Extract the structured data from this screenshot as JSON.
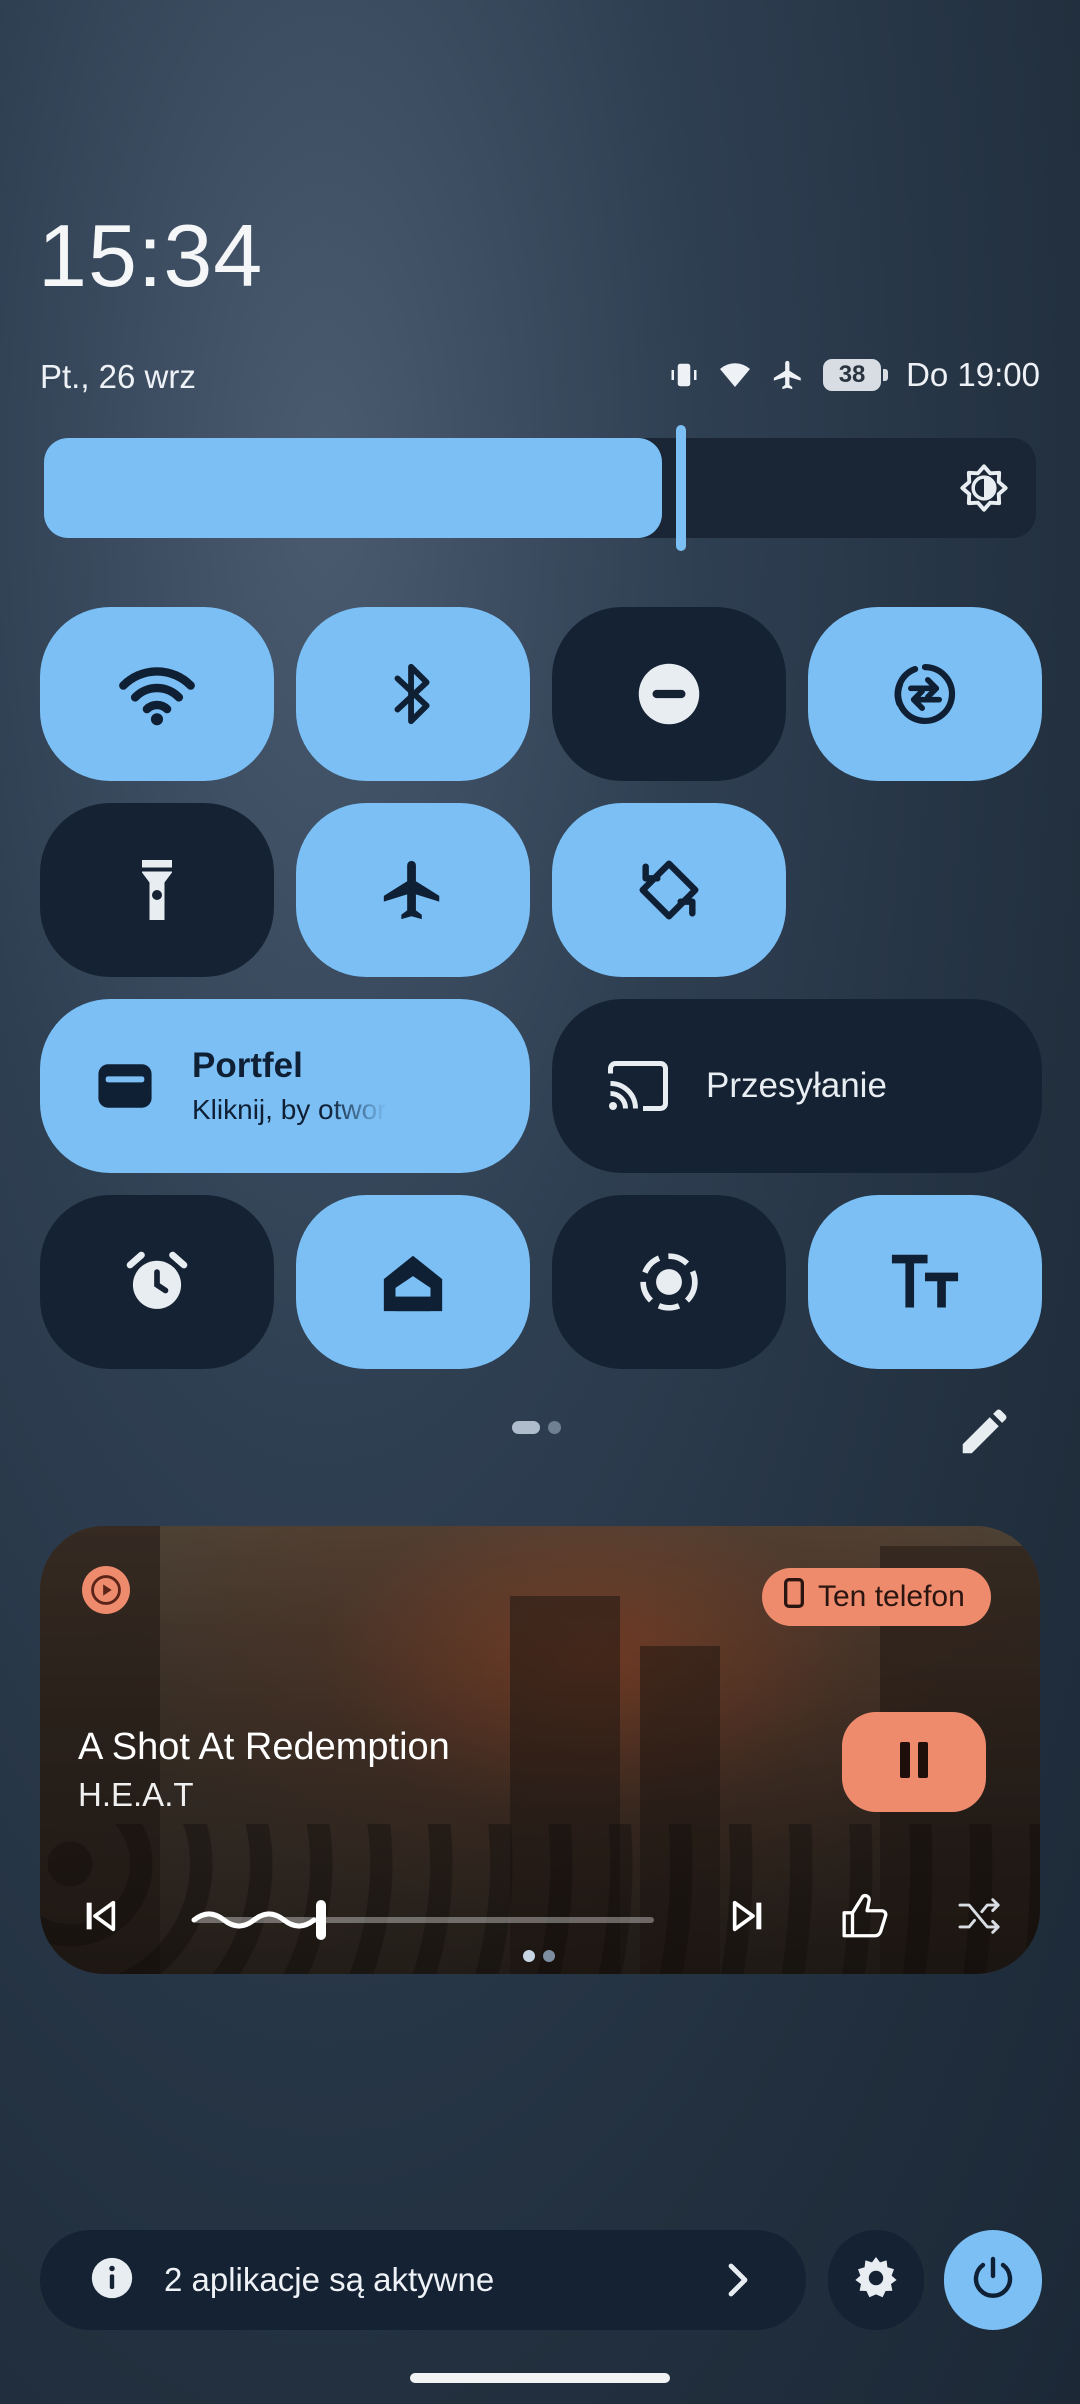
{
  "header": {
    "time": "15:34",
    "date": "Pt., 26 wrz",
    "battery_level": "38",
    "battery_label": "Do 19:00",
    "status_icons": [
      "vibrate-icon",
      "wifi-icon",
      "airplane-icon",
      "battery-icon"
    ]
  },
  "brightness": {
    "level_fraction": 0.62,
    "icon": "brightness-auto-icon"
  },
  "tiles": {
    "wifi": {
      "icon": "wifi-icon",
      "state": "on"
    },
    "bluetooth": {
      "icon": "bluetooth-icon",
      "state": "on"
    },
    "dnd": {
      "icon": "do-not-disturb-icon",
      "state": "off"
    },
    "data_saver": {
      "icon": "data-saver-icon",
      "state": "on"
    },
    "flashlight": {
      "icon": "flashlight-icon",
      "state": "off"
    },
    "airplane": {
      "icon": "airplane-icon",
      "state": "on"
    },
    "autorotate": {
      "icon": "auto-rotate-icon",
      "state": "on"
    },
    "wallet": {
      "title": "Portfel",
      "subtitle": "Kliknij, by otworzyć",
      "icon": "wallet-icon",
      "state": "on"
    },
    "cast": {
      "title": "Przesyłanie",
      "icon": "cast-icon",
      "state": "off"
    },
    "alarm": {
      "icon": "alarm-icon",
      "state": "off"
    },
    "home": {
      "icon": "home-icon",
      "state": "on"
    },
    "screen_record": {
      "icon": "screen-record-icon",
      "state": "off"
    },
    "font_size": {
      "icon": "font-size-icon",
      "state": "on"
    }
  },
  "pager": {
    "current": 1,
    "total": 2
  },
  "media": {
    "song": "A Shot At Redemption",
    "artist": "H.E.A.T",
    "output_device": "Ten telefon",
    "progress_fraction": 0.27,
    "pages": 2,
    "current_page": 1
  },
  "footer": {
    "active_apps_label": "2 aplikacje są aktywne"
  },
  "colors": {
    "accent": "#7bbff5",
    "tile_off": "#152233",
    "media_accent": "#ee8b6d"
  }
}
